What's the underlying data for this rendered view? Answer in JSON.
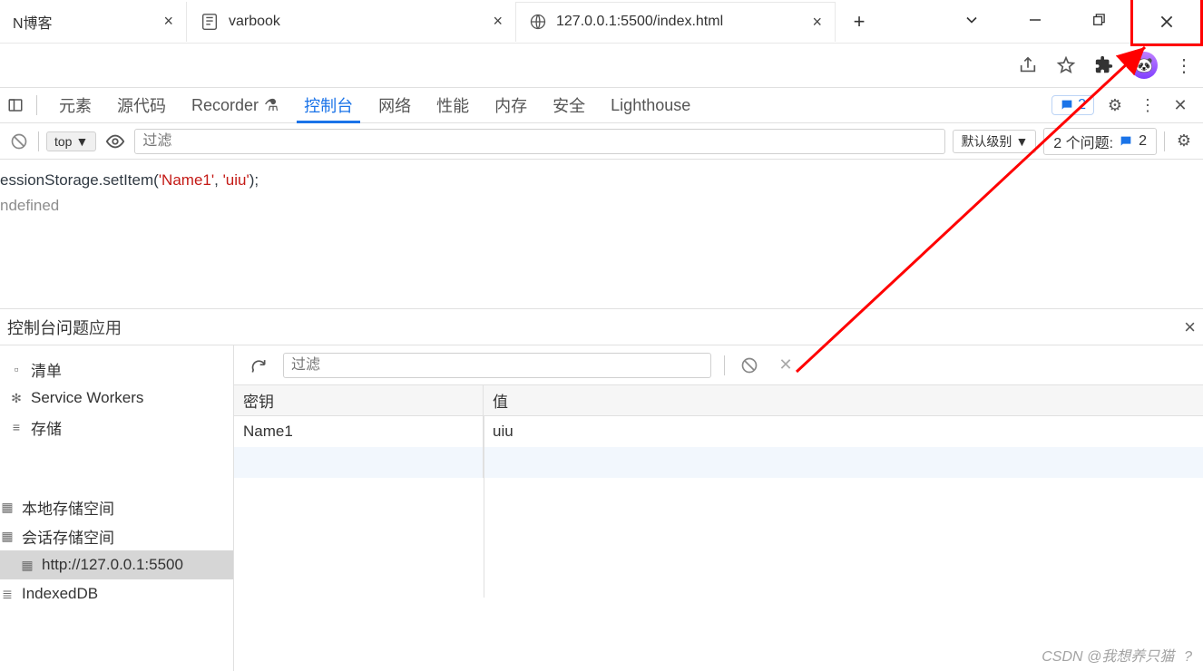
{
  "tabs": {
    "t0": {
      "title": "N博客"
    },
    "t1": {
      "title": "varbook"
    },
    "t2": {
      "title": "127.0.0.1:5500/index.html"
    }
  },
  "devtools": {
    "tabs": {
      "elements": "元素",
      "sources": "源代码",
      "recorder": "Recorder",
      "console": "控制台",
      "network": "网络",
      "performance": "性能",
      "memory": "内存",
      "security": "安全",
      "lighthouse": "Lighthouse"
    },
    "badge_count": "2"
  },
  "console_bar": {
    "context": "top",
    "filter_placeholder": "过滤",
    "level": "默认级别",
    "issues_text": "2 个问题:",
    "issues_badge": "2"
  },
  "console_output": {
    "code_pre": "essionStorage.setItem(",
    "arg1": "'Name1'",
    "sep": ", ",
    "arg2": "'uiu'",
    "code_post": ");",
    "result": "ndefined"
  },
  "drawer": {
    "console": "控制台",
    "issues": "问题",
    "application": "应用"
  },
  "sidebar": {
    "manifest": "清单",
    "sw": "Service Workers",
    "storage": "存储",
    "local": "本地存储空间",
    "session": "会话存储空间",
    "origin": "http://127.0.0.1:5500",
    "indexeddb": "IndexedDB"
  },
  "app_bar": {
    "filter_placeholder": "过滤"
  },
  "storage_table": {
    "head": {
      "key": "密钥",
      "value": "值"
    },
    "rows": [
      {
        "key": "Name1",
        "value": "uiu"
      }
    ]
  },
  "watermark": "CSDN @我想养只猫   ?"
}
